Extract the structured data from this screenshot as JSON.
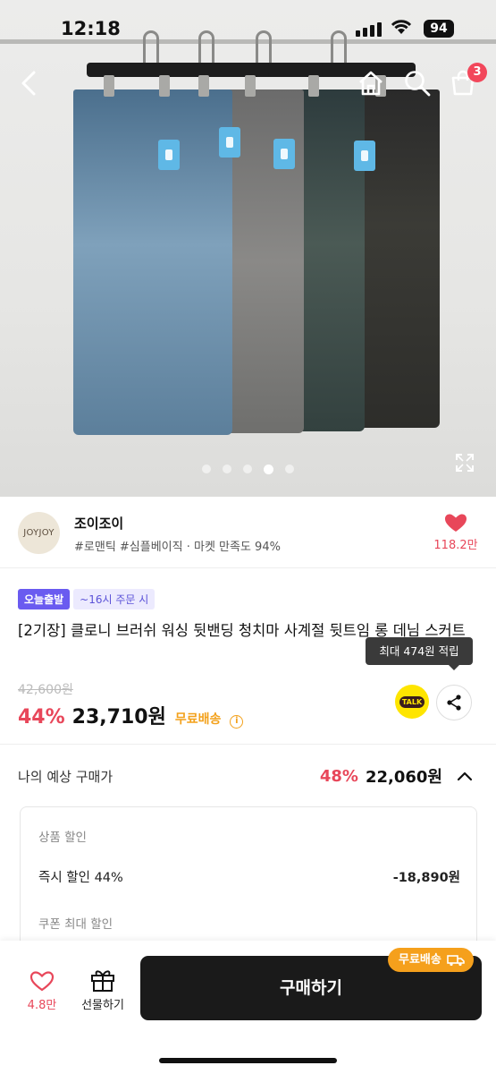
{
  "status": {
    "time": "12:18",
    "battery": "94"
  },
  "hero": {
    "cart_count": "3",
    "slides": 5,
    "active_slide": 4
  },
  "seller": {
    "logo_text": "JOYJOY",
    "name": "조이조이",
    "meta": "#로맨틱 #심플베이직 · 마켓 만족도 94%",
    "likes": "118.2만"
  },
  "product": {
    "badge_today": "오늘출발",
    "badge_time": "~16시 주문 시",
    "title": "[2기장] 클로니 브러쉬 워싱 뒷밴딩 청치마 사계절 뒷트임 롱 데님 스커트",
    "tooltip": "최대 474원 적립",
    "original_price": "42,600원",
    "discount": "44%",
    "price": "23,710원",
    "shipping": "무료배송",
    "info_icon": "i",
    "talk_label": "TALK"
  },
  "expected": {
    "label": "나의 예상 구매가",
    "discount": "48%",
    "price": "22,060원",
    "section1": "상품 할인",
    "row_label": "즉시 할인 44%",
    "row_value": "-18,890원",
    "section2": "쿠폰 최대 할인"
  },
  "bottom": {
    "likes": "4.8만",
    "gift": "선물하기",
    "buy": "구매하기",
    "free_ship": "무료배송"
  },
  "colors": {
    "accent_red": "#e8475a",
    "ship_orange": "#f3a11b",
    "badge_purple": "#6a5bf0"
  }
}
